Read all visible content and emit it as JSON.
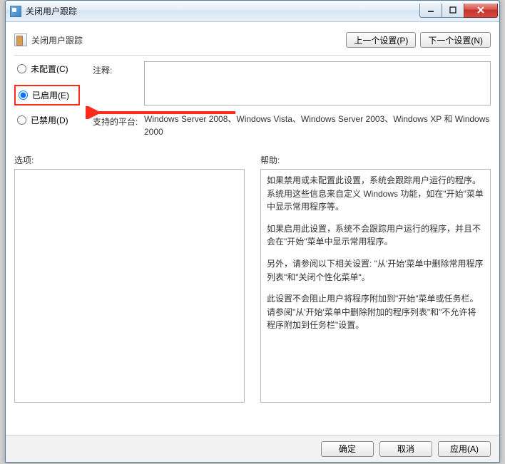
{
  "window": {
    "title": "关闭用户跟踪"
  },
  "header": {
    "title": "关闭用户跟踪",
    "prev": "上一个设置(P)",
    "next": "下一个设置(N)"
  },
  "radios": {
    "not_configured": "未配置(C)",
    "enabled": "已启用(E)",
    "disabled": "已禁用(D)",
    "selected": "enabled"
  },
  "fields": {
    "comment_label": "注释:",
    "comment_value": "",
    "platform_label": "支持的平台:",
    "platform_value": "Windows Server 2008、Windows Vista、Windows Server 2003、Windows XP 和 Windows 2000"
  },
  "panes": {
    "options_label": "选项:",
    "help_label": "帮助:",
    "help": {
      "p1": "如果禁用或未配置此设置，系统会跟踪用户运行的程序。系统用这些信息来自定义 Windows 功能，如在\"开始\"菜单中显示常用程序等。",
      "p2": "如果启用此设置，系统不会跟踪用户运行的程序，并且不会在\"开始\"菜单中显示常用程序。",
      "p3": "另外，请参阅以下相关设置: \"从'开始'菜单中删除常用程序列表\"和\"关闭个性化菜单\"。",
      "p4": "此设置不会阻止用户将程序附加到\"开始\"菜单或任务栏。请参阅\"从'开始'菜单中删除附加的程序列表\"和\"不允许将程序附加到任务栏\"设置。"
    }
  },
  "buttons": {
    "ok": "确定",
    "cancel": "取消",
    "apply": "应用(A)"
  }
}
